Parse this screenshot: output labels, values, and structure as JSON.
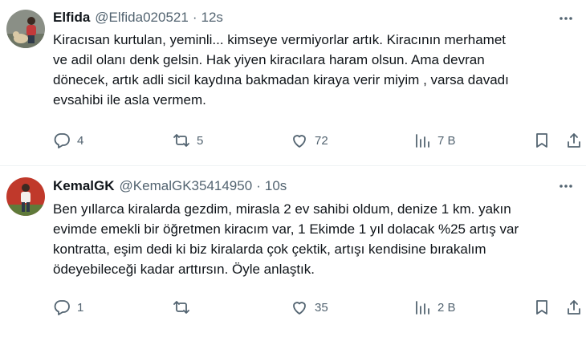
{
  "tweets": [
    {
      "name": "Elfida",
      "handle": "@Elfida020521",
      "separator": "·",
      "time": "12s",
      "text": "Kiracısan kurtulan, yeminli... kimseye vermiyorlar artık. Kiracının merhamet\nve adil olanı denk gelsin. Hak yiyen kiracılara haram olsun. Ama devran\ndönecek, artık adli sicil kaydına bakmadan kiraya verir miyim , varsa davadı\nevsahibi ile asla vermem.",
      "replies": "4",
      "retweets": "5",
      "likes": "72",
      "views": "7 B",
      "avatar_colors": {
        "bg": "#8a8f86",
        "figure": "#c23a3a",
        "dog": "#d9c9a6"
      }
    },
    {
      "name": "KemalGK",
      "handle": "@KemalGK35414950",
      "separator": "·",
      "time": "10s",
      "text": "Ben yıllarca kiralarda gezdim, mirasla 2 ev sahibi oldum, denize 1 km. yakın\nevimde emekli bir öğretmen kiracım var, 1 Ekimde 1 yıl dolacak %25 artış var\nkontratta, eşim dedi ki biz kiralarda çok çektik, artışı kendisine bırakalım\nödeyebileceği kadar arttırsın. Öyle anlaştık.",
      "replies": "1",
      "retweets": "",
      "likes": "35",
      "views": "2 B",
      "avatar_colors": {
        "bg": "#c0392b",
        "figure": "#f4f1ec",
        "ground": "#5f7a3a"
      }
    }
  ],
  "icons": [
    "reply-icon",
    "retweet-icon",
    "like-icon",
    "views-icon",
    "bookmark-icon",
    "share-icon",
    "more-icon"
  ],
  "colors": {
    "text": "#0f1419",
    "secondary": "#536471",
    "divider": "#eff3f4"
  }
}
